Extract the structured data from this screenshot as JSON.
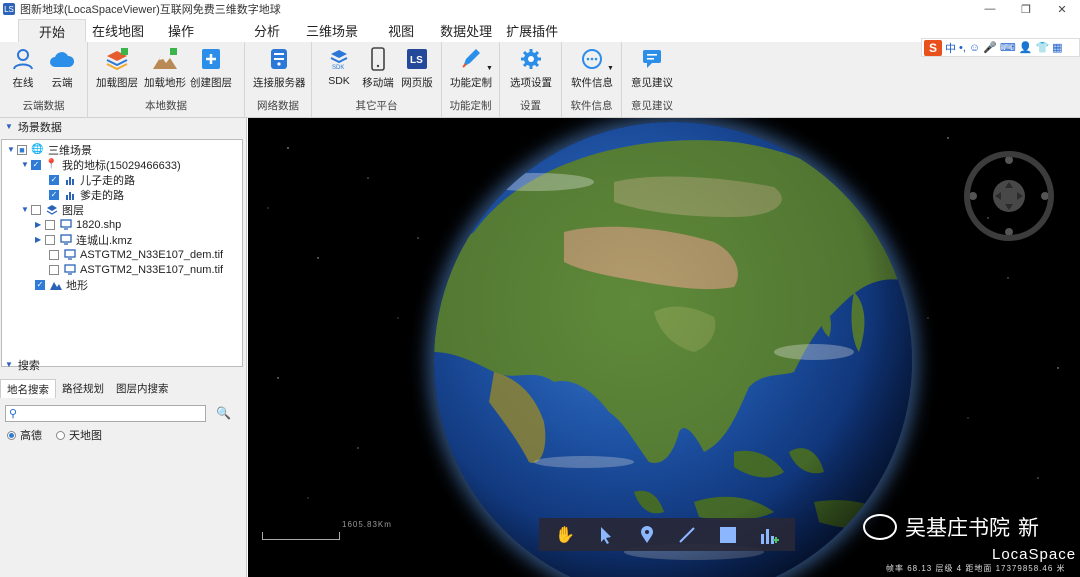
{
  "window": {
    "title": "图新地球(LocaSpaceViewer)互联网免费三维数字地球",
    "app_icon_text": "LS",
    "controls": [
      "—",
      "❐",
      "✕"
    ]
  },
  "tabs": [
    {
      "label": "开始",
      "active": true
    },
    {
      "label": "在线地图"
    },
    {
      "label": "操作"
    },
    {
      "label": "分析"
    },
    {
      "label": "三维场景"
    },
    {
      "label": "视图"
    },
    {
      "label": "数据处理"
    },
    {
      "label": "扩展插件"
    }
  ],
  "ribbon": {
    "groups": [
      {
        "label": "云端数据",
        "buttons": [
          {
            "label": "在线",
            "icon": "user-icon"
          },
          {
            "label": "云端",
            "icon": "cloud-icon"
          }
        ]
      },
      {
        "label": "本地数据",
        "buttons": [
          {
            "label": "加载图层",
            "icon": "layers-icon"
          },
          {
            "label": "加载地形",
            "icon": "terrain-icon"
          },
          {
            "label": "创建图层",
            "icon": "add-layer-icon"
          }
        ]
      },
      {
        "label": "网络数据",
        "buttons": [
          {
            "label": "连接服务器",
            "icon": "server-icon"
          }
        ]
      },
      {
        "label": "其它平台",
        "buttons": [
          {
            "label": "SDK",
            "icon": "sdk-icon"
          },
          {
            "label": "移动端",
            "icon": "mobile-icon"
          },
          {
            "label": "网页版",
            "icon": "web-icon"
          }
        ]
      },
      {
        "label": "功能定制",
        "buttons": [
          {
            "label": "功能定制",
            "icon": "pen-icon",
            "dropdown": true
          }
        ]
      },
      {
        "label": "设置",
        "buttons": [
          {
            "label": "选项设置",
            "icon": "gear-icon"
          }
        ]
      },
      {
        "label": "软件信息",
        "buttons": [
          {
            "label": "软件信息",
            "icon": "info-icon",
            "dropdown": true
          }
        ]
      },
      {
        "label": "意见建议",
        "buttons": [
          {
            "label": "意见建议",
            "icon": "chat-icon"
          }
        ]
      }
    ]
  },
  "ime": {
    "logo": "S",
    "lang": "中",
    "punct": "•,"
  },
  "scene_panel": {
    "header": "场景数据",
    "tree": [
      {
        "label": "三维场景",
        "level": 0,
        "expanded": true,
        "check": "partial",
        "icon": "globe-icon"
      },
      {
        "label": "我的地标(15029466633)",
        "level": 1,
        "expanded": true,
        "check": "on",
        "icon": "pin-icon"
      },
      {
        "label": "儿子走的路",
        "level": 2,
        "check": "on",
        "icon": "chart-icon"
      },
      {
        "label": "爹走的路",
        "level": 2,
        "check": "on",
        "icon": "chart-icon"
      },
      {
        "label": "图层",
        "level": 1,
        "expanded": true,
        "check": "off",
        "icon": "layers-icon"
      },
      {
        "label": "1820.shp",
        "level": 2,
        "collapsed": true,
        "check": "off",
        "icon": "monitor-icon"
      },
      {
        "label": "连城山.kmz",
        "level": 2,
        "collapsed": true,
        "check": "off",
        "icon": "monitor-icon"
      },
      {
        "label": "ASTGTM2_N33E107_dem.tif",
        "level": 2,
        "check": "off",
        "icon": "monitor-icon"
      },
      {
        "label": "ASTGTM2_N33E107_num.tif",
        "level": 2,
        "check": "off",
        "icon": "monitor-icon"
      },
      {
        "label": "地形",
        "level": 1,
        "check": "on",
        "icon": "terrain-icon"
      }
    ]
  },
  "search_panel": {
    "header": "搜索",
    "tabs": [
      "地名搜索",
      "路径规划",
      "图层内搜索"
    ],
    "active_tab": "地名搜索",
    "input_value": "",
    "options": [
      {
        "label": "高德",
        "selected": true
      },
      {
        "label": "天地图",
        "selected": false
      }
    ]
  },
  "map": {
    "scale_text": "1605.83Km",
    "tools": [
      "hand-icon",
      "pointer-icon",
      "pin-icon",
      "line-icon",
      "square-icon",
      "chart-add-icon"
    ],
    "watermark_text": "吴基庄书院",
    "watermark_suffix": "新",
    "brand_text": "LocaSpace",
    "status_text": "帧率 68.13  层级 4  距地面 17379858.46 米"
  }
}
